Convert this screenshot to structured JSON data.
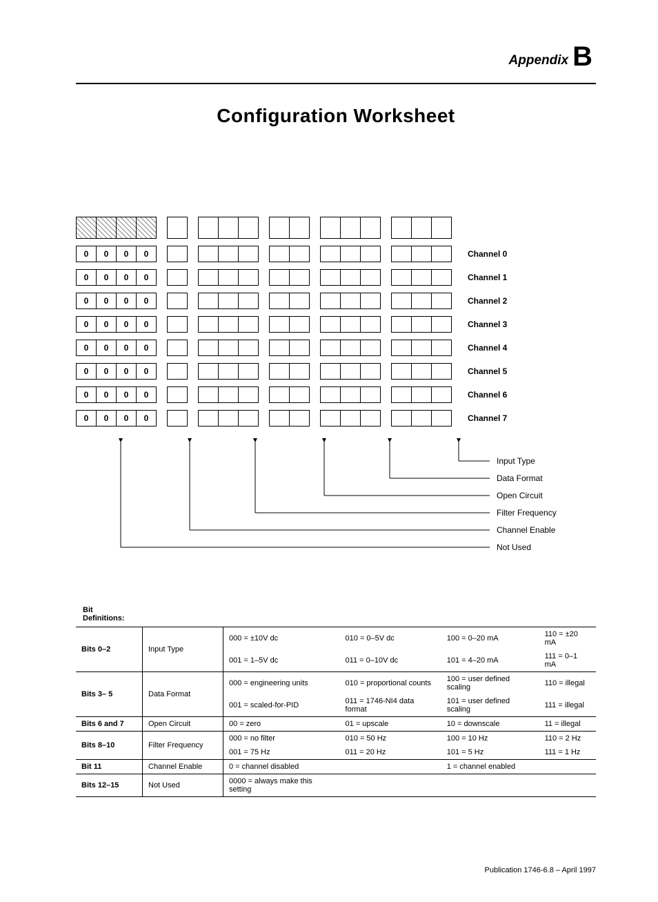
{
  "header": {
    "appendix_word": "Appendix",
    "appendix_letter": "B",
    "title": "Configuration Worksheet"
  },
  "channels": [
    {
      "label": "Channel 0",
      "fixed": [
        "0",
        "0",
        "0",
        "0"
      ]
    },
    {
      "label": "Channel 1",
      "fixed": [
        "0",
        "0",
        "0",
        "0"
      ]
    },
    {
      "label": "Channel 2",
      "fixed": [
        "0",
        "0",
        "0",
        "0"
      ]
    },
    {
      "label": "Channel 3",
      "fixed": [
        "0",
        "0",
        "0",
        "0"
      ]
    },
    {
      "label": "Channel 4",
      "fixed": [
        "0",
        "0",
        "0",
        "0"
      ]
    },
    {
      "label": "Channel 5",
      "fixed": [
        "0",
        "0",
        "0",
        "0"
      ]
    },
    {
      "label": "Channel 6",
      "fixed": [
        "0",
        "0",
        "0",
        "0"
      ]
    },
    {
      "label": "Channel 7",
      "fixed": [
        "0",
        "0",
        "0",
        "0"
      ]
    }
  ],
  "leaders": [
    "Input Type",
    "Data Format",
    "Open Circuit",
    "Filter Frequency",
    "Channel Enable",
    "Not Used"
  ],
  "defs_title": "Bit\nDefinitions:",
  "defs": [
    {
      "bits": "Bits 0–2",
      "name": "Input Type",
      "rows": [
        [
          "000 = ±10V dc",
          "010 = 0–5V dc",
          "100 = 0–20 mA",
          "110 = ±20 mA"
        ],
        [
          "001 = 1–5V dc",
          "011 = 0–10V dc",
          "101 = 4–20 mA",
          "111 = 0–1 mA"
        ]
      ]
    },
    {
      "bits": "Bits 3– 5",
      "name": "Data Format",
      "rows": [
        [
          "000 = engineering units",
          "010 = proportional counts",
          "100 = user defined scaling",
          "110 = illegal"
        ],
        [
          "001 = scaled-for-PID",
          "011 = 1746-NI4 data format",
          "101 = user defined scaling",
          "111 = illegal"
        ]
      ]
    },
    {
      "bits": "Bits 6 and 7",
      "name": "Open Circuit",
      "rows": [
        [
          "00 = zero",
          "01 = upscale",
          "10 = downscale",
          "11 = illegal"
        ]
      ]
    },
    {
      "bits": "Bits 8–10",
      "name": "Filter Frequency",
      "rows": [
        [
          "000 = no filter",
          "010 = 50 Hz",
          "100 = 10 Hz",
          "110 = 2 Hz"
        ],
        [
          "001 = 75 Hz",
          "011 = 20 Hz",
          "101 = 5 Hz",
          "111 = 1 Hz"
        ]
      ]
    },
    {
      "bits": "Bit 11",
      "name": "Channel Enable",
      "rows": [
        [
          "0 = channel disabled",
          "",
          "1 = channel enabled",
          ""
        ]
      ]
    },
    {
      "bits": "Bits 12–15",
      "name": "Not Used",
      "rows": [
        [
          "0000 = always make this setting",
          "",
          "",
          ""
        ]
      ]
    }
  ],
  "publication": "Publication 1746-6.8 – April 1997"
}
